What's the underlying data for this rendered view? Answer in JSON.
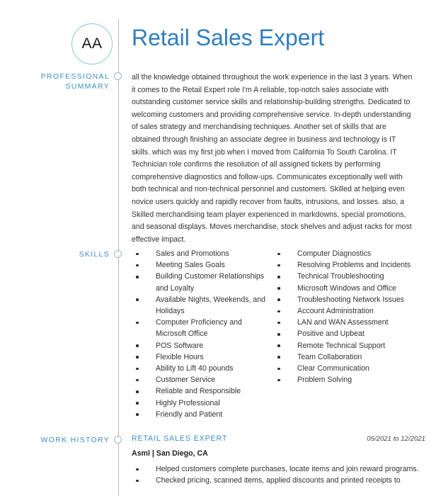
{
  "document": {
    "title": "Retail Sales Expert",
    "avatar_initials": "AA",
    "background_color": "#ffffff",
    "accent_color": "#2e7dbf",
    "label_color": "#3c8dc5"
  },
  "sections": {
    "summary": {
      "label_line1": "PROFESSIONAL",
      "label_line2": "SUMMARY",
      "body": "all the knowledge obtained throughout the work experience in the last 3 years. When it comes to the Retail Expert role I'm A reliable, top-notch sales associate with outstanding customer service skills and relationship-building strengths. Dedicated to welcoming customers and providing comprehensive service. In-depth understanding of sales strategy and merchandising techniques. Another set of skills that are obtained through finishing an associate degree in business and technology is IT skills. which was my first job when I moved from California To South Carolina. IT Technician role confirms the resolution of all assigned tickets by performing comprehensive diagnostics and follow-ups. Communicates exceptionally well with both technical and non-technical personnel and customers. Skilled at helping even novice users quickly and rapidly recover from faults, intrusions, and losses. also, a Skilled merchandising team player experienced in markdowns, special promotions, and seasonal displays. Moves merchandise, stock shelves and adjust racks for most effective impact."
    },
    "skills": {
      "label": "SKILLS",
      "column_left": [
        "Sales and Promotions",
        "Meeting Sales Goals",
        "Building Customer Relationships and Loyalty",
        "Available Nights, Weekends, and Holidays",
        "Computer Proficiency and Microsoft Office",
        "POS Software",
        "Flexible Hours",
        "Ability to Lift 40 pounds",
        "Customer Service",
        "Reliable and Responsible",
        "Highly Professional",
        "Friendly and Patient"
      ],
      "column_right": [
        "Computer Diagnostics",
        "Resolving Problems and Incidents",
        "Technical Troubleshooting",
        "Microsoft Windows and Office",
        "Troubleshooting Network Issues",
        "Account Administration",
        "LAN and WAN Assessment",
        "Positive and Upbeat",
        "Remote Technical Support",
        "Team Collaboration",
        "Clear Communication",
        "Problem Solving"
      ]
    },
    "work_history": {
      "label": "WORK HISTORY",
      "entries": [
        {
          "job_title": "RETAIL SALES EXPERT",
          "dates": "05/2021 to 12/2021",
          "company": "Asml | San Diego, CA",
          "duties": [
            "Helped customers complete purchases, locate items and join reward programs.",
            "Checked pricing, scanned items, applied discounts and printed receipts to"
          ]
        }
      ]
    }
  }
}
